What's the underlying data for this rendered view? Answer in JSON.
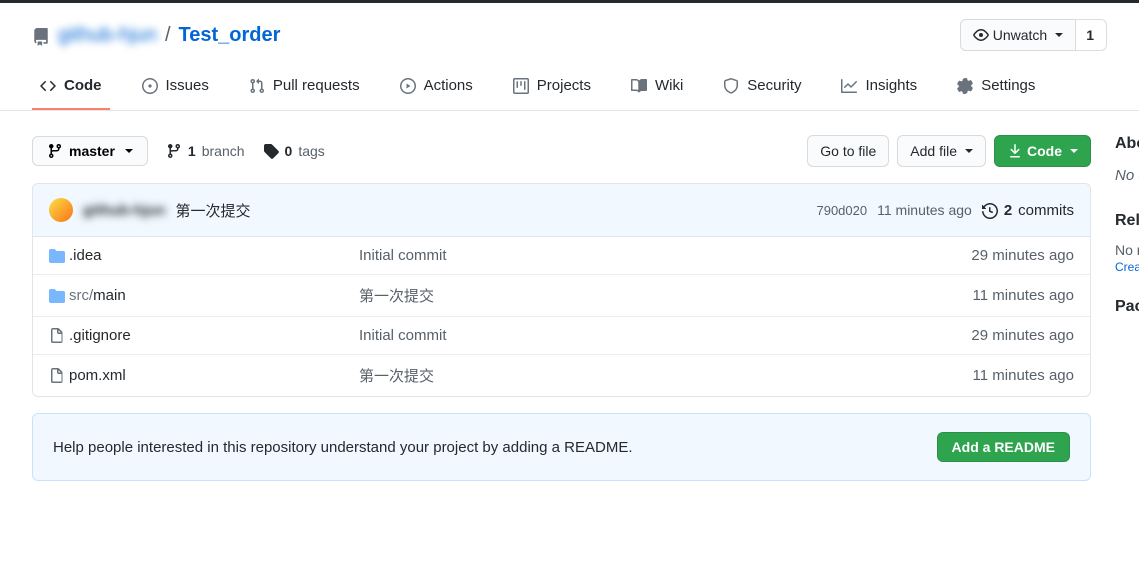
{
  "header": {
    "owner": "github-hjun",
    "repo": "Test_order",
    "unwatch_label": "Unwatch",
    "watch_count": "1"
  },
  "tabs": [
    {
      "label": "Code"
    },
    {
      "label": "Issues"
    },
    {
      "label": "Pull requests"
    },
    {
      "label": "Actions"
    },
    {
      "label": "Projects"
    },
    {
      "label": "Wiki"
    },
    {
      "label": "Security"
    },
    {
      "label": "Insights"
    },
    {
      "label": "Settings"
    }
  ],
  "branch": {
    "current": "master",
    "branches_count": "1",
    "branches_label": "branch",
    "tags_count": "0",
    "tags_label": "tags"
  },
  "actions": {
    "goto_file": "Go to file",
    "add_file": "Add file",
    "code": "Code"
  },
  "latest_commit": {
    "user": "github-hjun",
    "message": "第一次提交",
    "sha": "790d020",
    "time": "11 minutes ago",
    "commits_count": "2",
    "commits_label": "commits"
  },
  "files": [
    {
      "type": "folder",
      "name": ".idea",
      "msg": "Initial commit",
      "time": "29 minutes ago"
    },
    {
      "type": "folder",
      "name": "src/main",
      "msg": "第一次提交",
      "time": "11 minutes ago"
    },
    {
      "type": "file",
      "name": ".gitignore",
      "msg": "Initial commit",
      "time": "29 minutes ago"
    },
    {
      "type": "file",
      "name": "pom.xml",
      "msg": "第一次提交",
      "time": "11 minutes ago"
    }
  ],
  "readme_prompt": {
    "text": "Help people interested in this repository understand your project by adding a README.",
    "button": "Add a README"
  },
  "sidebar": {
    "about_title": "About",
    "about_desc": "No description, website, or topics provided.",
    "releases_title": "Releases",
    "releases_none": "No releases published",
    "releases_create": "Create a new release",
    "packages_title": "Packages"
  }
}
